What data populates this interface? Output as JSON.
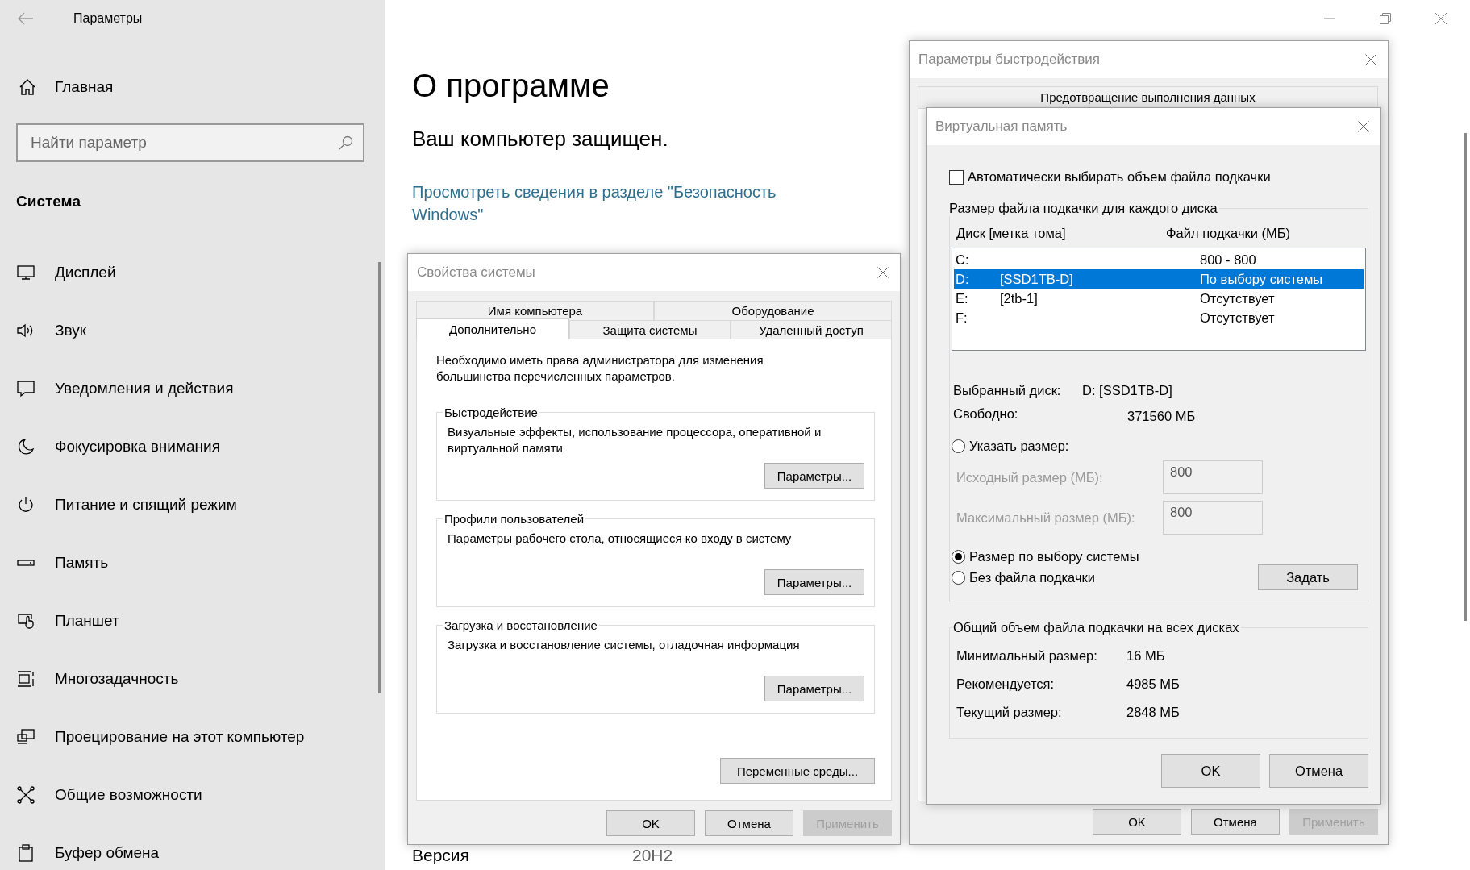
{
  "settings": {
    "title": "Параметры",
    "home": "Главная",
    "search": {
      "placeholder": "Найти параметр"
    },
    "section": "Система",
    "nav": [
      {
        "label": "Дисплей"
      },
      {
        "label": "Звук"
      },
      {
        "label": "Уведомления и действия"
      },
      {
        "label": "Фокусировка внимания"
      },
      {
        "label": "Питание и спящий режим"
      },
      {
        "label": "Память"
      },
      {
        "label": "Планшет"
      },
      {
        "label": "Многозадачность"
      },
      {
        "label": "Проецирование на этот компьютер"
      },
      {
        "label": "Общие возможности"
      },
      {
        "label": "Буфер обмена"
      }
    ]
  },
  "page": {
    "title": "О программе",
    "subtitle": "Ваш компьютер защищен.",
    "link": "Просмотреть сведения в разделе \"Безопасность Windows\"",
    "version_label": "Версия",
    "version_value": "20H2"
  },
  "system_properties": {
    "title": "Свойства системы",
    "tab_rows": [
      [
        {
          "label": "Имя компьютера",
          "selected": false
        },
        {
          "label": "Оборудование",
          "selected": false
        }
      ],
      [
        {
          "label": "Дополнительно",
          "selected": true
        },
        {
          "label": "Защита системы",
          "selected": false
        },
        {
          "label": "Удаленный доступ",
          "selected": false
        }
      ]
    ],
    "note": "Необходимо иметь права администратора для изменения большинства перечисленных параметров.",
    "groups": [
      {
        "legend": "Быстродействие",
        "text": "Визуальные эффекты, использование процессора, оперативной и виртуальной памяти",
        "button": "Параметры..."
      },
      {
        "legend": "Профили пользователей",
        "text": "Параметры рабочего стола, относящиеся ко входу в систему",
        "button": "Параметры..."
      },
      {
        "legend": "Загрузка и восстановление",
        "text": "Загрузка и восстановление системы, отладочная информация",
        "button": "Параметры..."
      }
    ],
    "env_button": "Переменные среды...",
    "buttons": [
      {
        "label": "OK",
        "disabled": false
      },
      {
        "label": "Отмена",
        "disabled": false
      },
      {
        "label": "Применить",
        "disabled": true
      }
    ]
  },
  "performance_options": {
    "title": "Параметры быстродействия",
    "tab": "Предотвращение выполнения данных",
    "buttons": [
      {
        "label": "OK",
        "disabled": false
      },
      {
        "label": "Отмена",
        "disabled": false
      },
      {
        "label": "Применить",
        "disabled": true
      }
    ]
  },
  "virtual_memory": {
    "title": "Виртуальная память",
    "auto": {
      "label": "Автоматически выбирать объем файла подкачки",
      "checked": false
    },
    "per_drive": {
      "legend": "Размер файла подкачки для каждого диска",
      "columns": [
        "Диск [метка тома]",
        "Файл подкачки (МБ)"
      ],
      "rows": [
        {
          "drive": "C:",
          "label": "",
          "size": "800 - 800",
          "selected": false
        },
        {
          "drive": "D:",
          "label": "[SSD1TB-D]",
          "size": "По выбору системы",
          "selected": true
        },
        {
          "drive": "E:",
          "label": "[2tb-1]",
          "size": "Отсутствует",
          "selected": false
        },
        {
          "drive": "F:",
          "label": "",
          "size": "Отсутствует",
          "selected": false
        }
      ],
      "selected_drive_label": "Выбранный диск:",
      "selected_drive_value": "D:  [SSD1TB-D]",
      "free_label": "Свободно:",
      "free_value": "371560 МБ",
      "options": [
        {
          "label": "Указать размер:",
          "selected": false
        },
        {
          "label": "Размер по выбору системы",
          "selected": true
        },
        {
          "label": "Без файла подкачки",
          "selected": false
        }
      ],
      "fields": [
        {
          "label": "Исходный размер (МБ):",
          "value": "800",
          "disabled": true
        },
        {
          "label": "Максимальный размер (МБ):",
          "value": "800",
          "disabled": true
        }
      ],
      "set_button": "Задать"
    },
    "totals": {
      "legend": "Общий объем файла подкачки на всех дисках",
      "rows": [
        {
          "label": "Минимальный размер:",
          "value": "16 МБ"
        },
        {
          "label": "Рекомендуется:",
          "value": "4985 МБ"
        },
        {
          "label": "Текущий размер:",
          "value": "2848 МБ"
        }
      ]
    },
    "buttons": [
      {
        "label": "OK",
        "disabled": false
      },
      {
        "label": "Отмена",
        "disabled": false
      }
    ]
  }
}
